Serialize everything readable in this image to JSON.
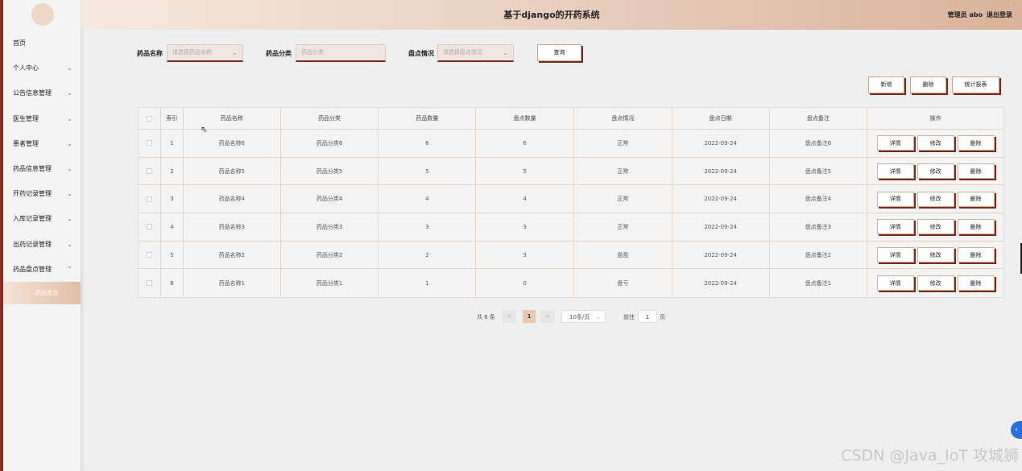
{
  "header": {
    "title": "基于django的开药系统",
    "role": "管理员 abo",
    "logout": "退出登录"
  },
  "sidebar": {
    "items": [
      {
        "label": "首页",
        "chevron": ""
      },
      {
        "label": "个人中心",
        "chevron": "⌄"
      },
      {
        "label": "公告信息管理",
        "chevron": "⌄"
      },
      {
        "label": "医生管理",
        "chevron": "⌄"
      },
      {
        "label": "患者管理",
        "chevron": "⌄"
      },
      {
        "label": "药品信息管理",
        "chevron": "⌄"
      },
      {
        "label": "开药记录管理",
        "chevron": "⌄"
      },
      {
        "label": "入库记录管理",
        "chevron": "⌄"
      },
      {
        "label": "出药记录管理",
        "chevron": "⌄"
      },
      {
        "label": "药品盘点管理",
        "chevron": "⌃"
      }
    ],
    "sub_active": "药品盘点"
  },
  "search": {
    "name_label": "药品名称",
    "name_placeholder": "请选择药品名称",
    "category_label": "药品分类",
    "category_placeholder": "药品分类",
    "status_label": "盘点情况",
    "status_placeholder": "请选择盘点情况",
    "query": "查询"
  },
  "actions": {
    "add": "新增",
    "delete": "删除",
    "report": "统计报表"
  },
  "table": {
    "headers": [
      "索引",
      "药品名称",
      "药品分类",
      "药品数量",
      "盘点数量",
      "盘点情况",
      "盘点日期",
      "盘点备注",
      "操作"
    ],
    "rows": [
      [
        "1",
        "药品名称6",
        "药品分类6",
        "6",
        "6",
        "正常",
        "2022-09-24",
        "盘点备注6"
      ],
      [
        "2",
        "药品名称5",
        "药品分类5",
        "5",
        "5",
        "正常",
        "2022-09-24",
        "盘点备注5"
      ],
      [
        "3",
        "药品名称4",
        "药品分类4",
        "4",
        "4",
        "正常",
        "2022-09-24",
        "盘点备注4"
      ],
      [
        "4",
        "药品名称3",
        "药品分类3",
        "3",
        "3",
        "正常",
        "2022-09-24",
        "盘点备注3"
      ],
      [
        "5",
        "药品名称2",
        "药品分类2",
        "2",
        "3",
        "盘盈",
        "2022-09-24",
        "盘点备注2"
      ],
      [
        "6",
        "药品名称1",
        "药品分类1",
        "1",
        "0",
        "盘亏",
        "2022-09-24",
        "盘点备注1"
      ]
    ],
    "op_detail": "详情",
    "op_edit": "修改",
    "op_delete": "删除"
  },
  "pagination": {
    "total": "共 6 条",
    "prev": "<",
    "current": "1",
    "next": ">",
    "page_size": "10条/页",
    "goto": "前往",
    "goto_value": "1",
    "page_unit": "页"
  },
  "watermark": "CSDN @Java_IoT 攻城狮"
}
